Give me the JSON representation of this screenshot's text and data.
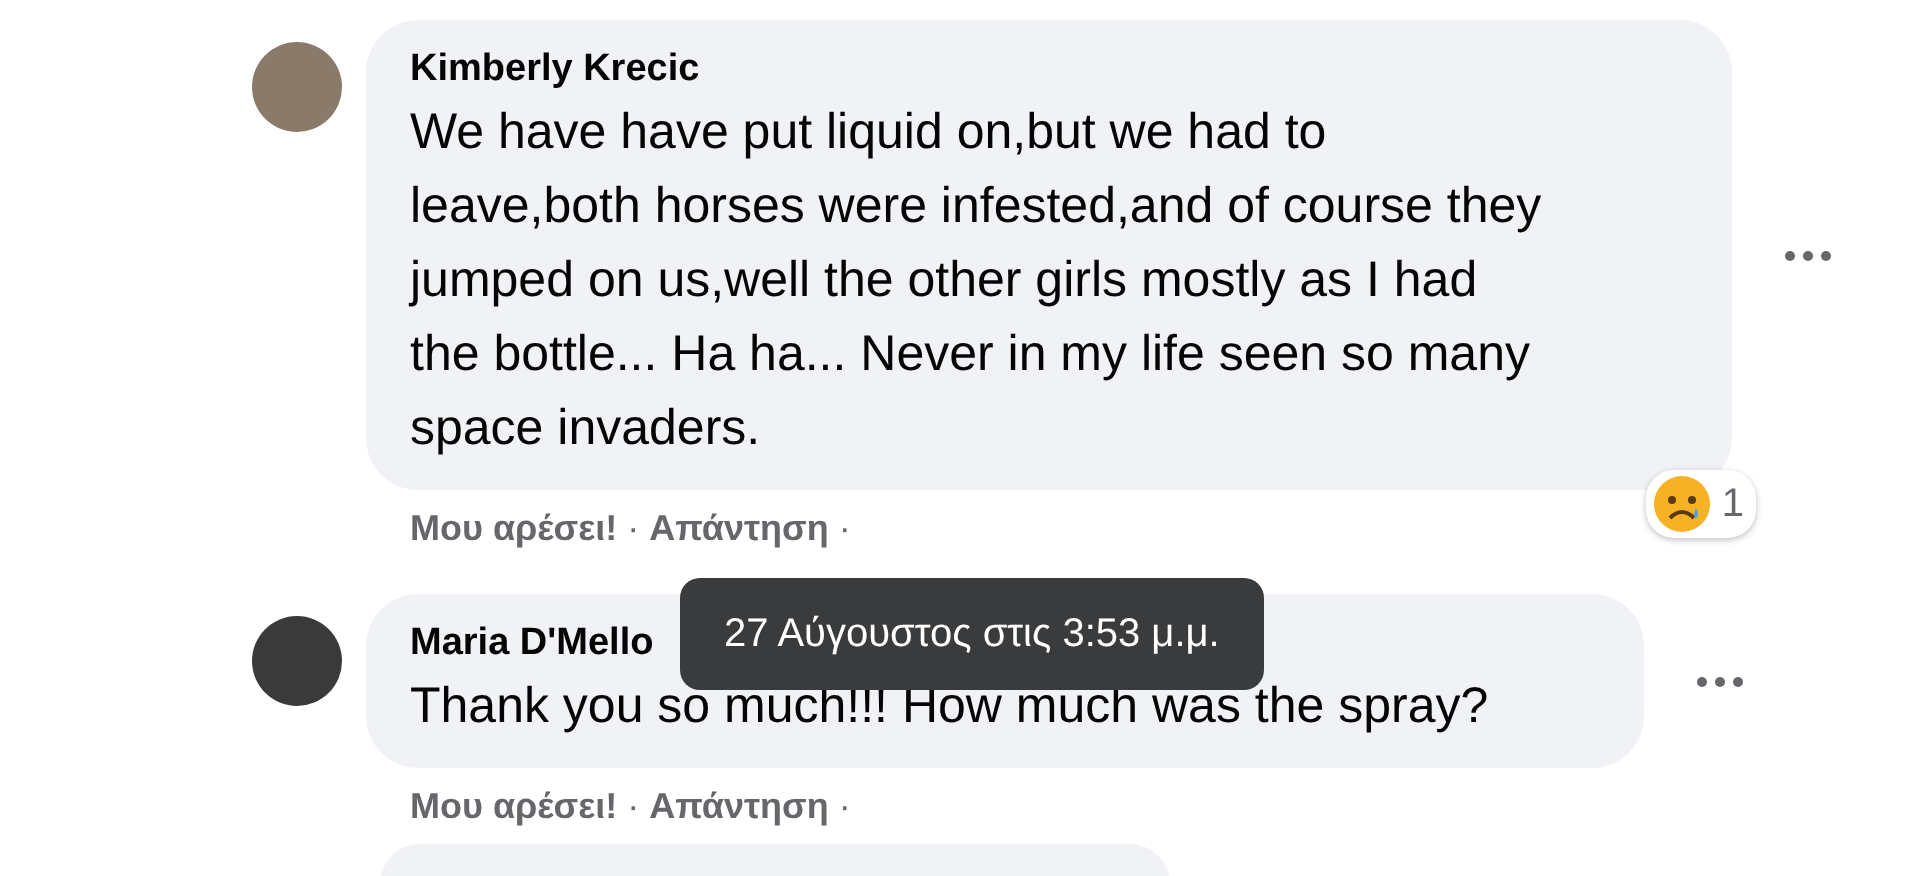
{
  "comments": [
    {
      "author": "Kimberly Krecic",
      "body_lines": [
        "We have have put liquid on,but we had to",
        "leave,both horses were infested,and of course they",
        "jumped on us,well the other girls mostly as I had",
        "the bottle... Ha ha... Never in my life seen so many",
        "space invaders."
      ],
      "reaction": {
        "count": "1"
      },
      "actions": [
        "Μου αρέσει!",
        "·",
        "Απάντηση",
        "·"
      ]
    },
    {
      "author": "Maria D'Mello",
      "body_lines": [
        "Thank you so much!!! How much was the spray?"
      ],
      "actions": [
        "Μου αρέσει!",
        "·",
        "Απάντηση",
        "·"
      ]
    }
  ],
  "tooltip": {
    "text": "27 Αύγουστος στις 3:53 μ.μ."
  }
}
